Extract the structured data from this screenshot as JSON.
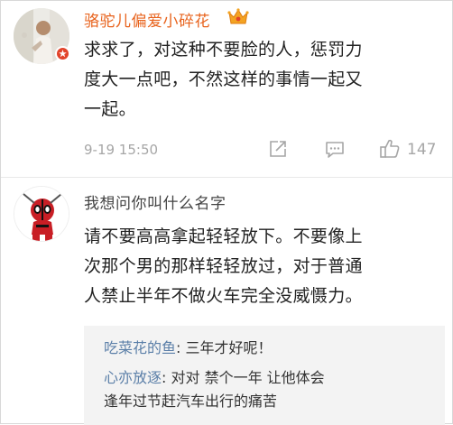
{
  "comments": [
    {
      "author": "骆驼儿偏爱小碎花",
      "lines": [
        "求求了，对这种不要脸的人，惩罚力",
        "度大一点吧，不然这样的事情一起又",
        "一起。"
      ],
      "timestamp": "9-19 15:50",
      "like_count": "147",
      "author_color": "#e8631d"
    },
    {
      "author": "我想问你叫什么名字",
      "lines": [
        "请不要高高拿起轻轻放下。不要像上",
        "次那个男的那样轻轻放过，对于普通",
        "人禁止半年不做火车完全没威慑力。"
      ],
      "author_color": "#444444"
    }
  ],
  "replies": [
    {
      "name": "吃菜花的鱼",
      "separator": ": ",
      "text": "三年才好呢！"
    },
    {
      "name": "心亦放逐",
      "separator": ": ",
      "text_line1": "对对 禁个一年 让他体会",
      "text_line2": "逢年过节赶汽车出行的痛苦"
    }
  ]
}
